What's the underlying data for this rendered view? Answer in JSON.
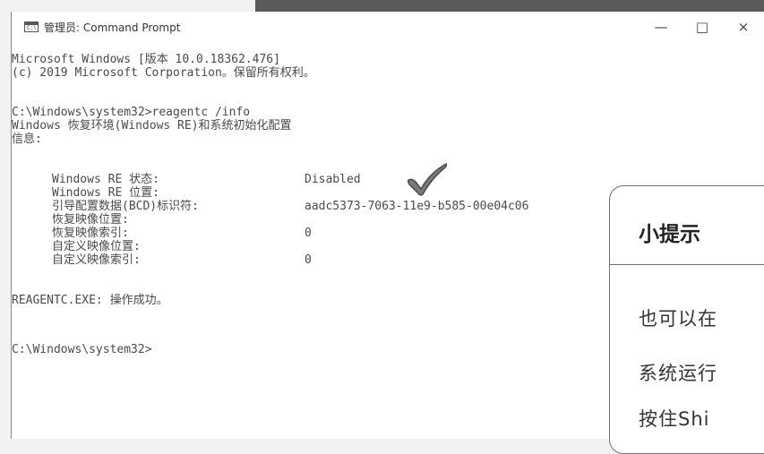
{
  "window": {
    "title": "管理员: Command Prompt",
    "icon_text": "C:\\",
    "controls": {
      "minimize": "—",
      "maximize": "□",
      "close": "×"
    }
  },
  "console": {
    "lines": [
      "Microsoft Windows [版本 10.0.18362.476]",
      "(c) 2019 Microsoft Corporation。保留所有权利。",
      "",
      "C:\\Windows\\system32>reagentc /info",
      "Windows 恢复环境(Windows RE)和系统初始化配置",
      "信息:"
    ],
    "info_rows": [
      {
        "label": "Windows RE 状态:",
        "value": "Disabled"
      },
      {
        "label": "Windows RE 位置:",
        "value": ""
      },
      {
        "label": "引导配置数据(BCD)标识符:",
        "value": "aadc5373-7063-11e9-b585-00e04c06"
      },
      {
        "label": "恢复映像位置:",
        "value": ""
      },
      {
        "label": "恢复映像索引:",
        "value": "0"
      },
      {
        "label": "自定义映像位置:",
        "value": ""
      },
      {
        "label": "自定义映像索引:",
        "value": "0"
      }
    ],
    "result": "REAGENTC.EXE: 操作成功。",
    "prompt": "C:\\Windows\\system32>"
  },
  "tip": {
    "title": "小提示",
    "lines": [
      "也可以在",
      "系统运行",
      "按住Shi"
    ]
  },
  "colors": {
    "console_text": "#4a4a4a",
    "card_border": "#6e6e6e",
    "checkmark": "#7a7a7a"
  },
  "icons": {
    "checkmark": "checkmark-icon",
    "window": "cmd-icon"
  }
}
